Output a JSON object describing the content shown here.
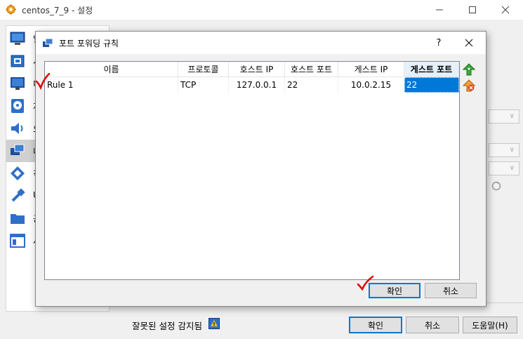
{
  "parent": {
    "title": "centos_7_9 - 설정",
    "sidebar": [
      {
        "label": "일",
        "icon": "general-icon"
      },
      {
        "label": "시",
        "icon": "system-icon"
      },
      {
        "label": "디",
        "icon": "display-icon"
      },
      {
        "label": "저",
        "icon": "storage-icon"
      },
      {
        "label": "오",
        "icon": "audio-icon"
      },
      {
        "label": "네",
        "icon": "network-icon"
      },
      {
        "label": "직",
        "icon": "serial-ports-icon"
      },
      {
        "label": "U",
        "icon": "usb-icon"
      },
      {
        "label": "공",
        "icon": "shared-folders-icon"
      },
      {
        "label": "사",
        "icon": "user-interface-icon"
      }
    ],
    "invalid_settings": "잘못된 설정 감지됨",
    "buttons": {
      "ok": "확인",
      "cancel": "취소",
      "help": "도움말(H)"
    }
  },
  "dialog": {
    "title": "포트 포워딩 규칙",
    "help": "?",
    "columns": [
      "이름",
      "프로토콜",
      "호스트 IP",
      "호스트 포트",
      "게스트 IP",
      "게스트 포트"
    ],
    "rows": [
      {
        "name": "Rule 1",
        "protocol": "TCP",
        "host_ip": "127.0.0.1",
        "host_port": "22",
        "guest_ip": "10.0.2.15",
        "guest_port": "22"
      }
    ],
    "buttons": {
      "ok": "확인",
      "cancel": "취소"
    }
  },
  "colors": {
    "selection": "#0078d7",
    "annotation": "#e00000",
    "add_icon": "#3aa83a",
    "remove_icon": "#d94a2b"
  }
}
